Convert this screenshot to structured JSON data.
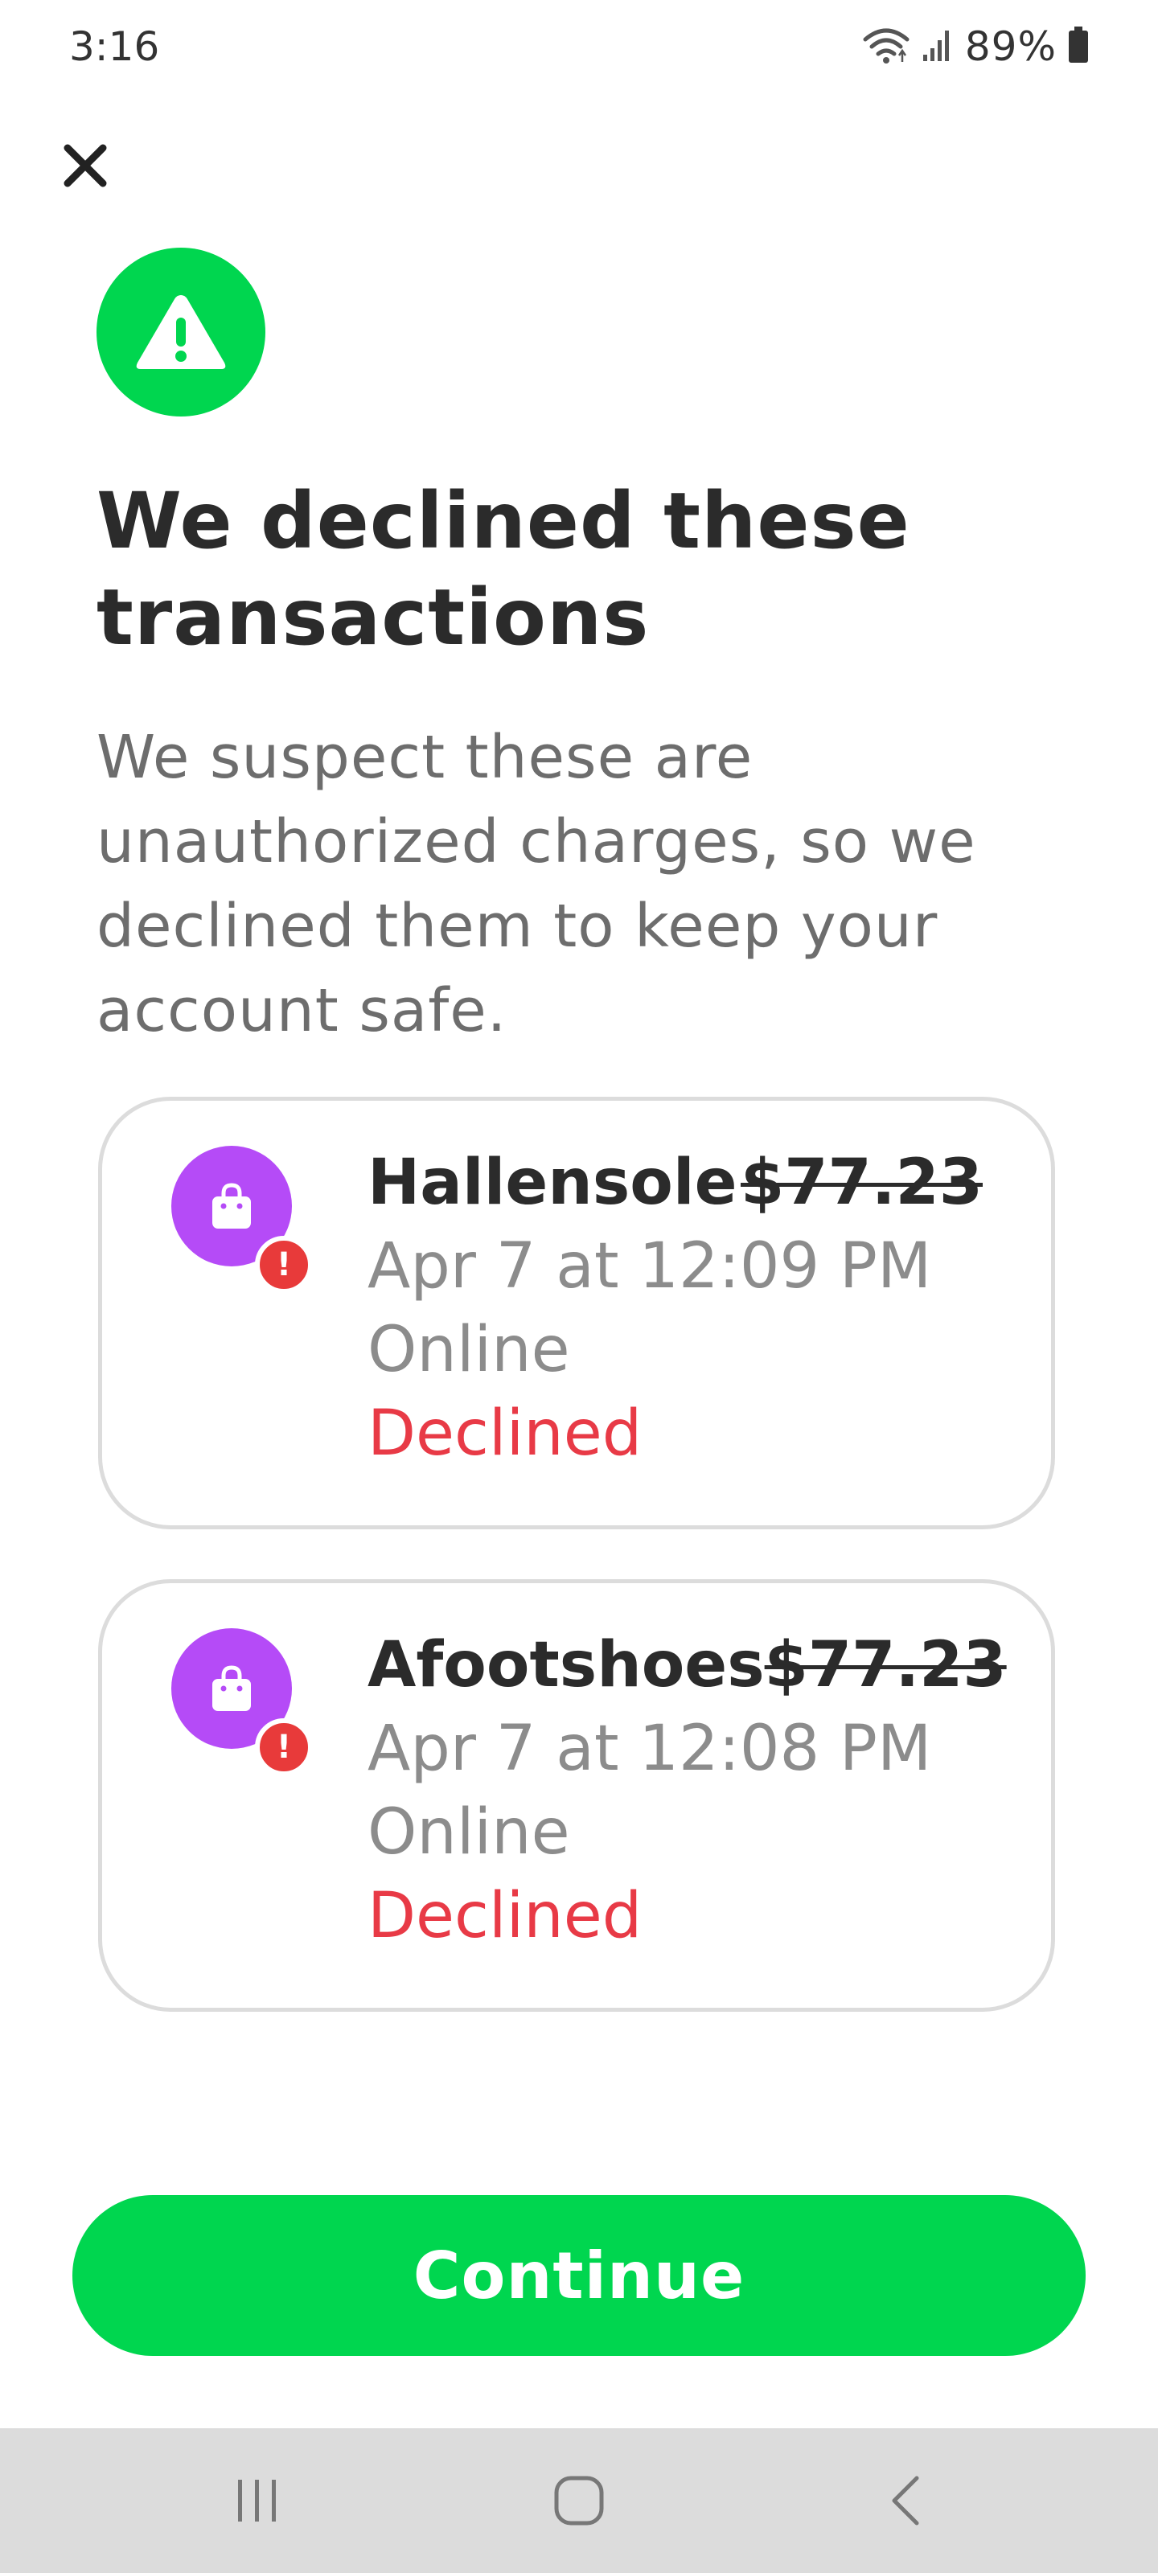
{
  "status_bar": {
    "time": "3:16",
    "battery_percent": "89%",
    "icons": [
      "wifi-icon",
      "signal-icon",
      "battery-icon"
    ]
  },
  "header": {
    "close_icon": "close-icon"
  },
  "hero": {
    "icon": "warning-icon",
    "icon_bg_color": "#00d64f",
    "title": "We declined these transactions",
    "description": "We suspect these are unauthorized charges, so we declined them to keep your account safe."
  },
  "transactions": [
    {
      "merchant": "Hallensole",
      "amount": "$77.23",
      "datetime": "Apr 7 at 12:09 PM",
      "channel": "Online",
      "status": "Declined",
      "icon": "shopping-bag-icon",
      "badge_icon": "alert-icon"
    },
    {
      "merchant": "Afootshoes",
      "amount": "$77.23",
      "datetime": "Apr 7 at 12:08 PM",
      "channel": "Online",
      "status": "Declined",
      "icon": "shopping-bag-icon",
      "badge_icon": "alert-icon"
    }
  ],
  "actions": {
    "continue_label": "Continue",
    "continue_color": "#00d64f"
  },
  "colors": {
    "declined": "#e83a46",
    "avatar": "#b54bf7",
    "badge": "#e83a3a"
  },
  "nav_bar": {
    "buttons": [
      "recent-apps-icon",
      "home-icon",
      "back-icon"
    ]
  }
}
